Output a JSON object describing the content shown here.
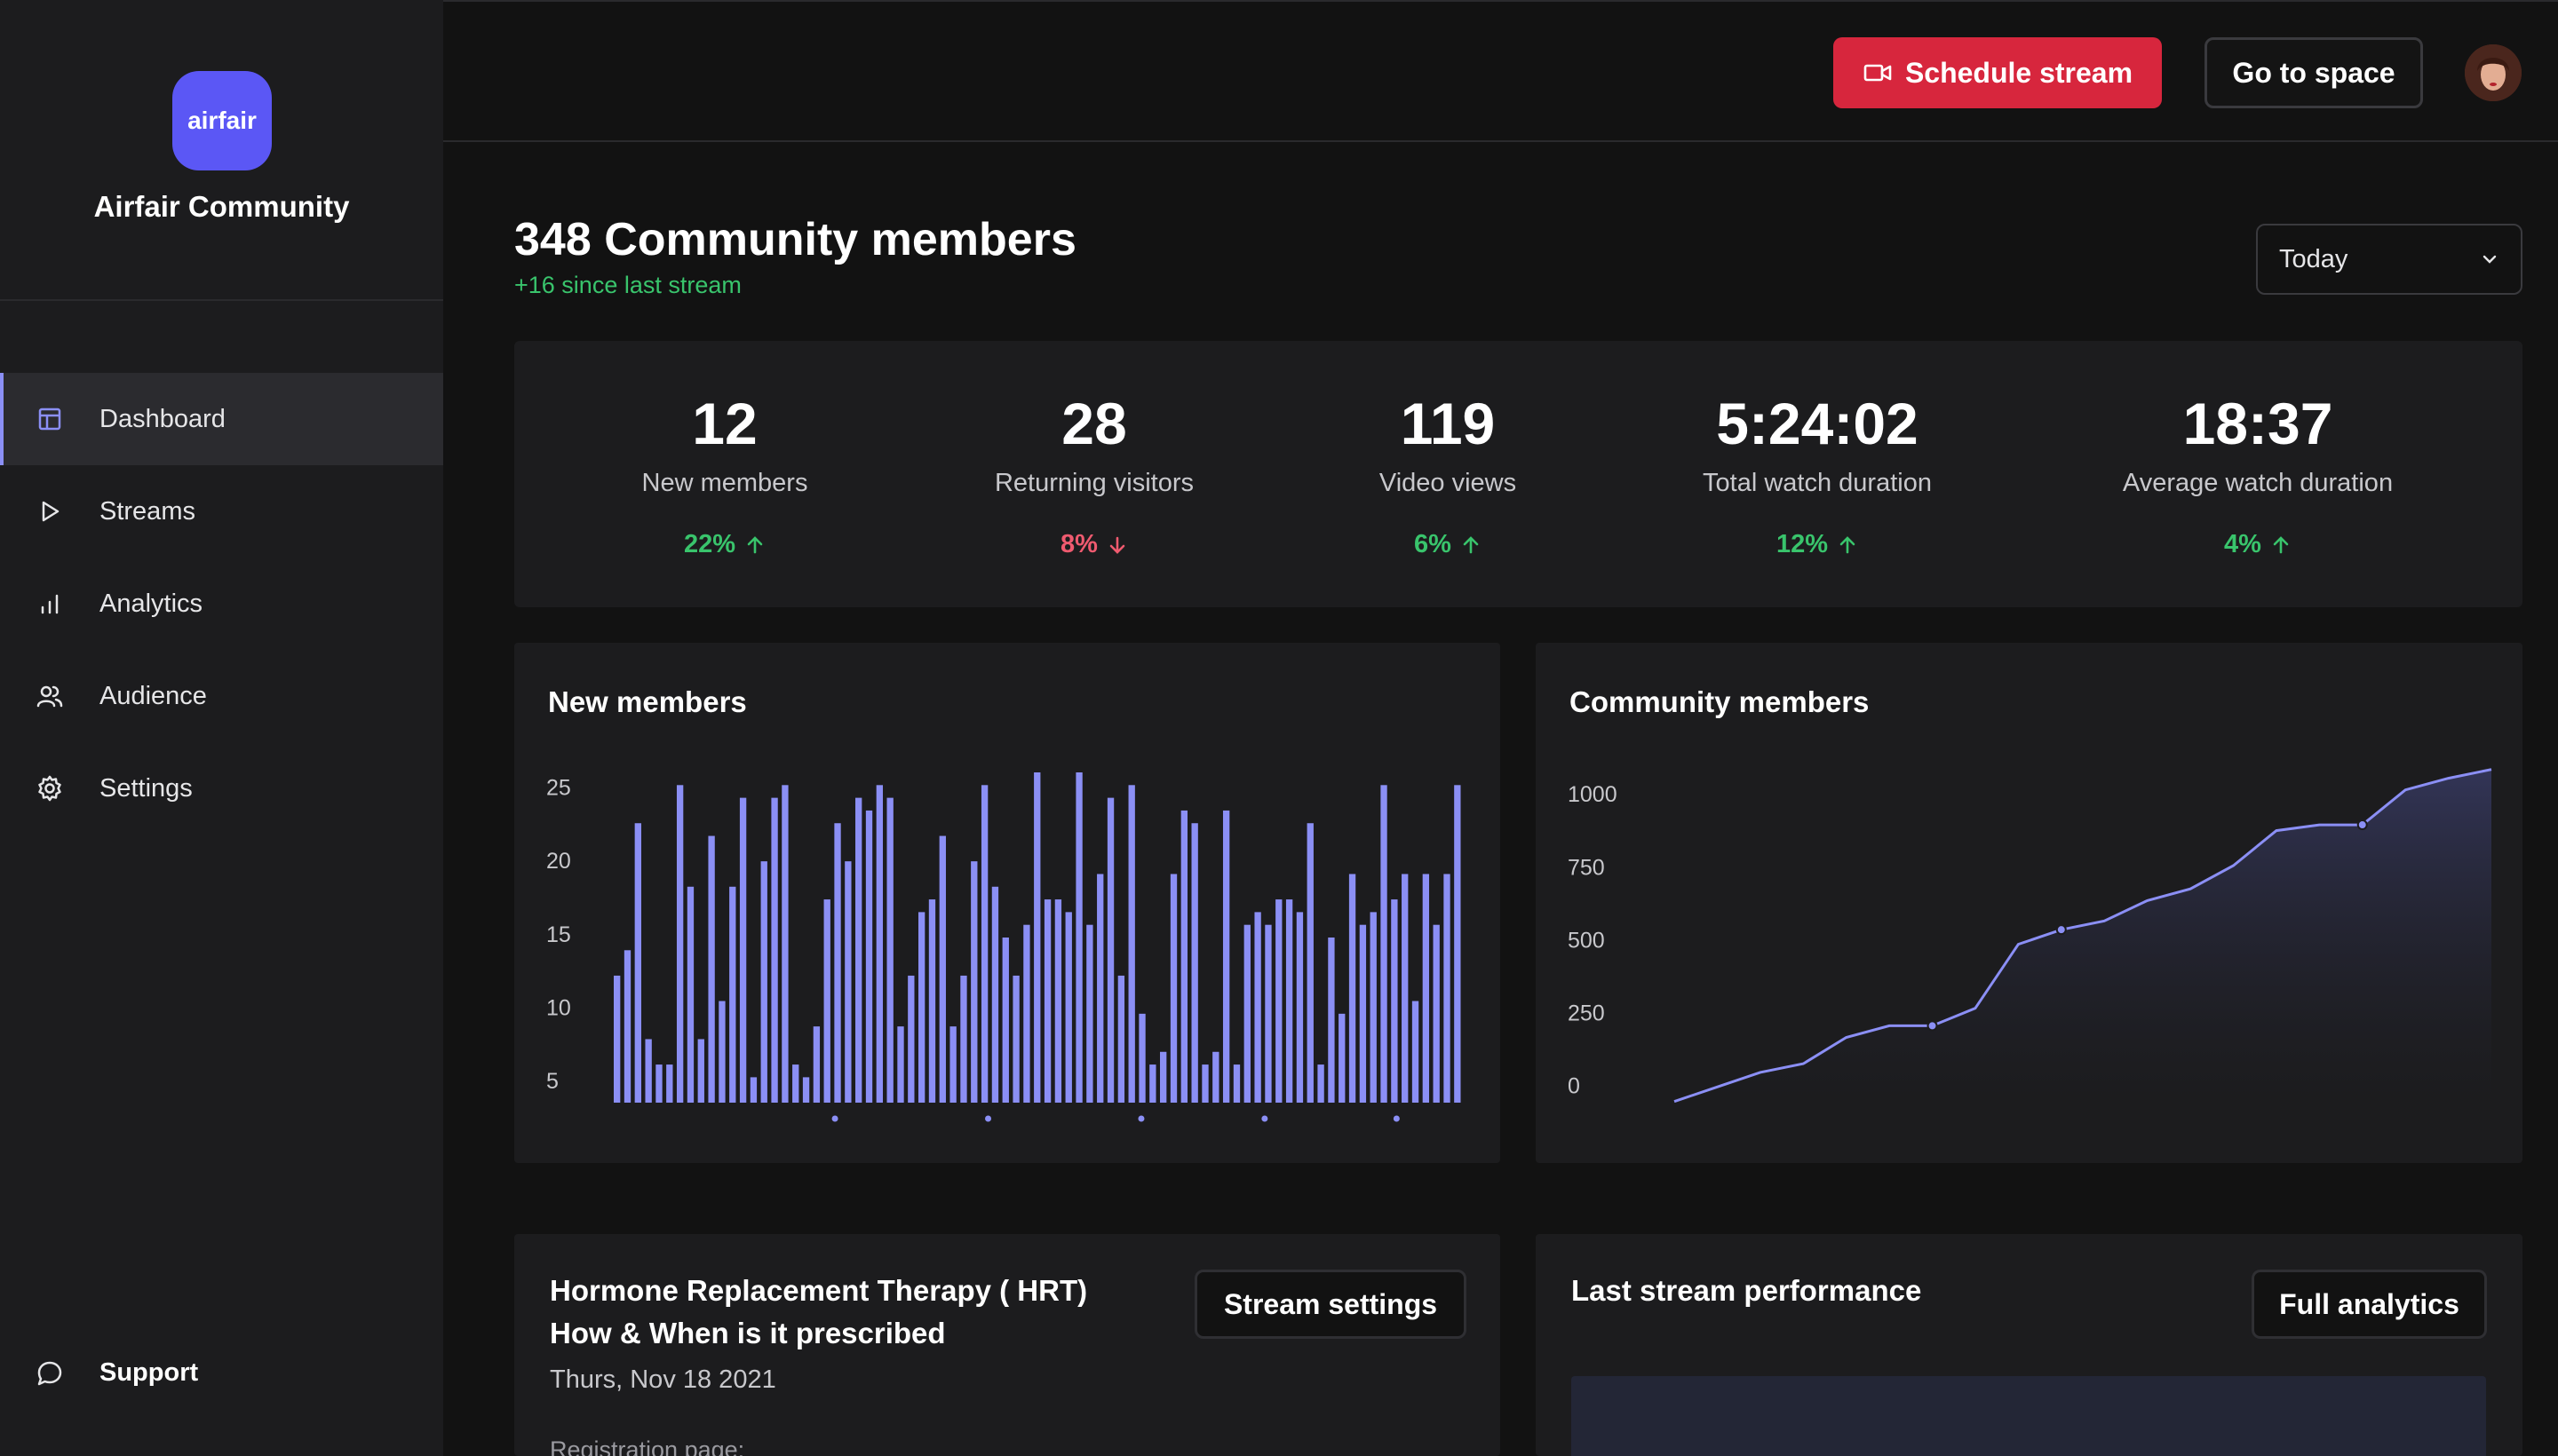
{
  "sidebar": {
    "logo_text": "airfair",
    "brand_name": "Airfair Community",
    "items": [
      {
        "label": "Dashboard",
        "icon": "dashboard-icon",
        "active": true
      },
      {
        "label": "Streams",
        "icon": "play-icon"
      },
      {
        "label": "Analytics",
        "icon": "bar-chart-icon"
      },
      {
        "label": "Audience",
        "icon": "users-icon"
      },
      {
        "label": "Settings",
        "icon": "gear-icon"
      }
    ],
    "support_label": "Support"
  },
  "topbar": {
    "schedule_label": "Schedule stream",
    "space_label": "Go to space"
  },
  "header": {
    "title": "348 Community members",
    "subtitle": "+16 since last stream",
    "range_value": "Today"
  },
  "stats": [
    {
      "value": "12",
      "label": "New members",
      "change": "22%",
      "direction": "up"
    },
    {
      "value": "28",
      "label": "Returning visitors",
      "change": "8%",
      "direction": "down"
    },
    {
      "value": "119",
      "label": "Video views",
      "change": "6%",
      "direction": "up"
    },
    {
      "value": "5:24:02",
      "label": "Total watch duration",
      "change": "12%",
      "direction": "up"
    },
    {
      "value": "18:37",
      "label": "Average watch duration",
      "change": "4%",
      "direction": "up"
    }
  ],
  "colors": {
    "accent": "#8b8ff5",
    "brand": "#5b57f5",
    "danger": "#d7263d",
    "positive": "#39c46c",
    "negative": "#ef5a6f"
  },
  "chart_data": [
    {
      "type": "bar",
      "title": "New members",
      "ylim": [
        0,
        25
      ],
      "yticks": [
        "25",
        "20",
        "15",
        "10",
        "5"
      ],
      "values": [
        10,
        12,
        22,
        5,
        3,
        3,
        25,
        17,
        5,
        21,
        8,
        17,
        24,
        2,
        19,
        24,
        25,
        3,
        2,
        6,
        16,
        22,
        19,
        24,
        23,
        25,
        24,
        6,
        10,
        15,
        16,
        21,
        6,
        10,
        19,
        25,
        17,
        13,
        10,
        14,
        26,
        16,
        16,
        15,
        26,
        14,
        18,
        24,
        10,
        25,
        7,
        3,
        4,
        18,
        23,
        22,
        3,
        4,
        23,
        3,
        14,
        15,
        14,
        16,
        16,
        15,
        22,
        3,
        13,
        7,
        18,
        14,
        15,
        25,
        16,
        18,
        8,
        18,
        14,
        18,
        25
      ]
    },
    {
      "type": "area",
      "title": "Community members",
      "yticks": [
        "1000",
        "750",
        "500",
        "250",
        "0"
      ],
      "ylim": [
        0,
        1000
      ],
      "values": [
        -50,
        0,
        50,
        80,
        170,
        210,
        210,
        270,
        490,
        540,
        570,
        640,
        680,
        760,
        880,
        900,
        900,
        1020,
        1060,
        1090
      ]
    }
  ],
  "stream_panel": {
    "title": "Hormone Replacement Therapy ( HRT) How & When is it prescribed",
    "date": "Thurs, Nov 18 2021",
    "registration_label": "Registration page:",
    "settings_label": "Stream settings"
  },
  "performance_panel": {
    "title": "Last stream performance",
    "analytics_label": "Full analytics"
  }
}
